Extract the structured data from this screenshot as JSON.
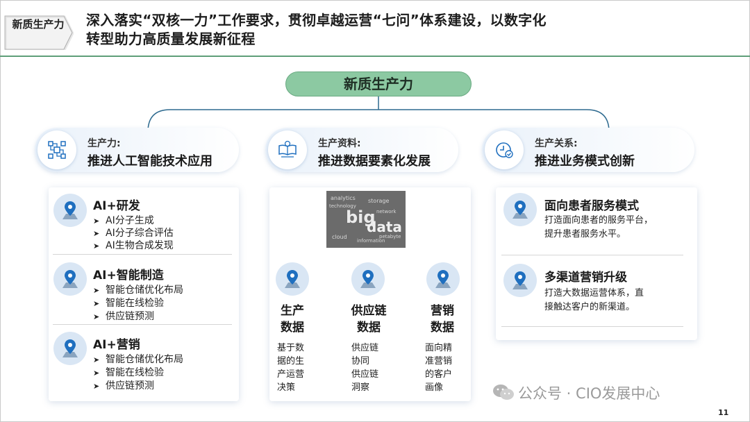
{
  "header": {
    "tag": "新质生产力",
    "headline_line1": "深入落实“双核一力”工作要求，贯彻卓越运营“七问”体系建设，以数字化",
    "headline_line2": "转型助力高质量发展新征程"
  },
  "root": {
    "label": "新质生产力"
  },
  "categories": [
    {
      "sub": "生产力:",
      "main": "推进人工智能技术应用",
      "icon": "circuit-icon"
    },
    {
      "sub": "生产资料:",
      "main": "推进数据要素化发展",
      "icon": "book-brain-icon"
    },
    {
      "sub": "生产关系:",
      "main": "推进业务模式创新",
      "icon": "clock-check-icon"
    }
  ],
  "left_items": [
    {
      "title": "AI+研发",
      "bullets": [
        "AI分子生成",
        "AI分子综合评估",
        "AI生物合成发现"
      ]
    },
    {
      "title": "AI+智能制造",
      "bullets": [
        "智能仓储优化布局",
        "智能在线检验",
        "供应链预测"
      ]
    },
    {
      "title": "AI+营销",
      "bullets": [
        "智能仓储优化布局",
        "智能在线检验",
        "供应链预测"
      ]
    }
  ],
  "data_image": {
    "words": [
      "big",
      "data",
      "analytics",
      "storage",
      "cloud",
      "information",
      "technology",
      "network",
      "petabyte"
    ]
  },
  "data_columns": [
    {
      "title_line1": "生产",
      "title_line2": "数据",
      "desc": [
        "基于数",
        "据的生",
        "产运营",
        "决策"
      ]
    },
    {
      "title_line1": "供应链",
      "title_line2": "数据",
      "desc": [
        "供应链",
        "协同",
        "供应链",
        "洞察"
      ]
    },
    {
      "title_line1": "营销",
      "title_line2": "数据",
      "desc": [
        "面向精",
        "准营销",
        "的客户",
        "画像"
      ]
    }
  ],
  "right_items": [
    {
      "title": "面向患者服务模式",
      "desc": [
        "打造面向患者的服务平台，",
        "提升患者服务水平。"
      ]
    },
    {
      "title": "多渠道营销升级",
      "desc": [
        "打造大数据运营体系，直",
        "接触达客户的新渠道。"
      ]
    }
  ],
  "watermark": "公众号 · CIO发展中心",
  "page_number": "11",
  "colors": {
    "accent_green": "#5e9e78",
    "pill_green": "#8cc9a2",
    "icon_blue": "#1f6fbf",
    "pin_bg": "#d9e6f4"
  }
}
